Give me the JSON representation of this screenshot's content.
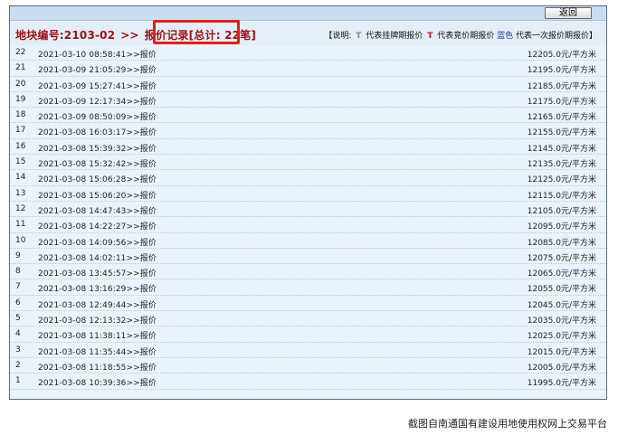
{
  "topbar": {
    "back_label": "返回"
  },
  "header": {
    "plot_label": "地块编号:2103-02",
    "arrow": ">>",
    "section_label": "报价记录",
    "count_label": "[总计: 22笔]",
    "legend": {
      "prefix": "【说明:",
      "listing_marker": "T",
      "listing_text": "代表挂牌期报价",
      "bidding_marker": "T",
      "bidding_text": "代表竞价期报价",
      "blue_label": "蓝色",
      "blue_text": "代表一次报价期报价】"
    }
  },
  "bids": [
    {
      "idx": "22",
      "time": "2021-03-10 08:58:41>>报价",
      "price": "12205.0元/平方米"
    },
    {
      "idx": "21",
      "time": "2021-03-09 21:05:29>>报价",
      "price": "12195.0元/平方米"
    },
    {
      "idx": "20",
      "time": "2021-03-09 15:27:41>>报价",
      "price": "12185.0元/平方米"
    },
    {
      "idx": "19",
      "time": "2021-03-09 12:17:34>>报价",
      "price": "12175.0元/平方米"
    },
    {
      "idx": "18",
      "time": "2021-03-09 08:50:09>>报价",
      "price": "12165.0元/平方米"
    },
    {
      "idx": "17",
      "time": "2021-03-08 16:03:17>>报价",
      "price": "12155.0元/平方米"
    },
    {
      "idx": "16",
      "time": "2021-03-08 15:39:32>>报价",
      "price": "12145.0元/平方米"
    },
    {
      "idx": "15",
      "time": "2021-03-08 15:32:42>>报价",
      "price": "12135.0元/平方米"
    },
    {
      "idx": "14",
      "time": "2021-03-08 15:06:28>>报价",
      "price": "12125.0元/平方米"
    },
    {
      "idx": "13",
      "time": "2021-03-08 15:06:20>>报价",
      "price": "12115.0元/平方米"
    },
    {
      "idx": "12",
      "time": "2021-03-08 14:47:43>>报价",
      "price": "12105.0元/平方米"
    },
    {
      "idx": "11",
      "time": "2021-03-08 14:22:27>>报价",
      "price": "12095.0元/平方米"
    },
    {
      "idx": "10",
      "time": "2021-03-08 14:09:56>>报价",
      "price": "12085.0元/平方米"
    },
    {
      "idx": "9",
      "time": "2021-03-08 14:02:11>>报价",
      "price": "12075.0元/平方米"
    },
    {
      "idx": "8",
      "time": "2021-03-08 13:45:57>>报价",
      "price": "12065.0元/平方米"
    },
    {
      "idx": "7",
      "time": "2021-03-08 13:16:29>>报价",
      "price": "12055.0元/平方米"
    },
    {
      "idx": "6",
      "time": "2021-03-08 12:49:44>>报价",
      "price": "12045.0元/平方米"
    },
    {
      "idx": "5",
      "time": "2021-03-08 12:13:32>>报价",
      "price": "12035.0元/平方米"
    },
    {
      "idx": "4",
      "time": "2021-03-08 11:38:11>>报价",
      "price": "12025.0元/平方米"
    },
    {
      "idx": "3",
      "time": "2021-03-08 11:35:44>>报价",
      "price": "12015.0元/平方米"
    },
    {
      "idx": "2",
      "time": "2021-03-08 11:18:55>>报价",
      "price": "12005.0元/平方米"
    },
    {
      "idx": "1",
      "time": "2021-03-08 10:39:36>>报价",
      "price": "11995.0元/平方米"
    }
  ],
  "caption": "截图自南通国有建设用地使用权网上交易平台",
  "colors": {
    "title_red": "#9b1111",
    "highlight_red": "#e0201a",
    "row_background": "#eaf3fb"
  }
}
